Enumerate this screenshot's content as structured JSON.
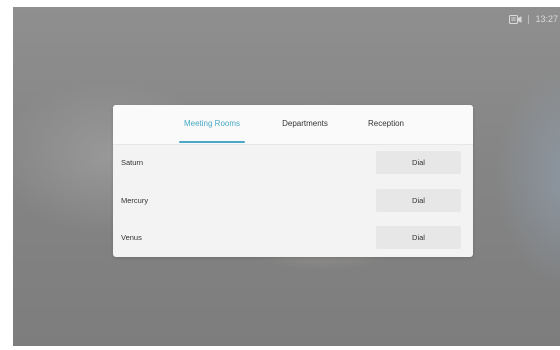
{
  "status": {
    "time": "13:27",
    "icon": "camera-share-icon"
  },
  "directory": {
    "tabs": [
      {
        "label": "Meeting Rooms",
        "active": true
      },
      {
        "label": "Departments",
        "active": false
      },
      {
        "label": "Reception",
        "active": false
      }
    ],
    "rows": [
      {
        "name": "Saturn",
        "action": "Dial"
      },
      {
        "name": "Mercury",
        "action": "Dial"
      },
      {
        "name": "Venus",
        "action": "Dial"
      }
    ]
  },
  "colors": {
    "accent": "#49a9c6",
    "panel": "#f3f3f3",
    "button": "#e7e7e7"
  }
}
